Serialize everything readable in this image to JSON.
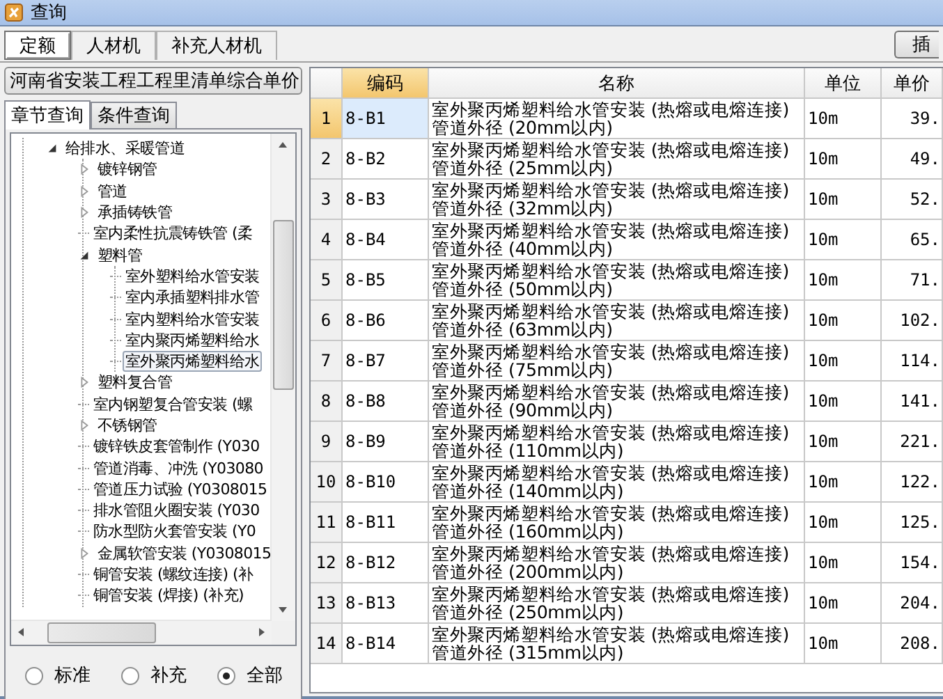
{
  "window": {
    "title": "查询"
  },
  "tabs": [
    {
      "label": "定额",
      "selected": true
    },
    {
      "label": "人材机",
      "selected": false
    },
    {
      "label": "补充人材机",
      "selected": false
    }
  ],
  "insert_button": {
    "label": "插"
  },
  "library_select": {
    "value": "河南省安装工程工程里清单综合单价"
  },
  "sub_tabs": [
    {
      "label": "章节查询",
      "selected": true
    },
    {
      "label": "条件查询",
      "selected": false
    }
  ],
  "tree": [
    {
      "label": "给排水、采暖管道",
      "kind": "node",
      "expanded": true,
      "selected": false,
      "children": [
        {
          "label": "镀锌钢管",
          "kind": "node",
          "expanded": false,
          "selected": false
        },
        {
          "label": "管道",
          "kind": "node",
          "expanded": false,
          "selected": false
        },
        {
          "label": "承插铸铁管",
          "kind": "node",
          "expanded": false,
          "selected": false
        },
        {
          "label": "室内柔性抗震铸铁管 (柔",
          "kind": "leaf",
          "selected": false
        },
        {
          "label": "塑料管",
          "kind": "node",
          "expanded": true,
          "selected": false,
          "children": [
            {
              "label": "室外塑料给水管安装",
              "kind": "leaf",
              "selected": false
            },
            {
              "label": "室内承插塑料排水管",
              "kind": "leaf",
              "selected": false
            },
            {
              "label": "室内塑料给水管安装",
              "kind": "leaf",
              "selected": false
            },
            {
              "label": "室内聚丙烯塑料给水",
              "kind": "leaf",
              "selected": false
            },
            {
              "label": "室外聚丙烯塑料给水",
              "kind": "leaf",
              "selected": true
            }
          ]
        },
        {
          "label": "塑料复合管",
          "kind": "node",
          "expanded": false,
          "selected": false
        },
        {
          "label": "室内钢塑复合管安装 (螺",
          "kind": "leaf",
          "selected": false
        },
        {
          "label": "不锈钢管",
          "kind": "node",
          "expanded": false,
          "selected": false
        },
        {
          "label": "镀锌铁皮套管制作 (Y030",
          "kind": "leaf",
          "selected": false
        },
        {
          "label": "管道消毒、冲洗 (Y03080",
          "kind": "leaf",
          "selected": false
        },
        {
          "label": "管道压力试验 (Y0308015",
          "kind": "leaf",
          "selected": false
        },
        {
          "label": "排水管阻火圈安装 (Y030",
          "kind": "leaf",
          "selected": false
        },
        {
          "label": "防水型防火套管安装 (Y0",
          "kind": "leaf",
          "selected": false
        },
        {
          "label": "金属软管安装 (Y0308015",
          "kind": "node",
          "expanded": false,
          "selected": false
        },
        {
          "label": "铜管安装 (螺纹连接) (补",
          "kind": "leaf",
          "selected": false
        },
        {
          "label": "铜管安装 (焊接) (补充)",
          "kind": "leaf",
          "selected": false
        }
      ]
    }
  ],
  "filter": [
    {
      "label": "标准",
      "selected": false
    },
    {
      "label": "补充",
      "selected": false
    },
    {
      "label": "全部",
      "selected": true
    }
  ],
  "table": {
    "columns": [
      "编码",
      "名称",
      "单位",
      "单价"
    ],
    "rows": [
      {
        "index": "1",
        "code": "8-B1",
        "name": "室外聚丙烯塑料给水管安装 (热熔或电熔连接) 管道外径 (20mm以内)",
        "unit": "10m",
        "price": "39.",
        "selected": true
      },
      {
        "index": "2",
        "code": "8-B2",
        "name": "室外聚丙烯塑料给水管安装 (热熔或电熔连接) 管道外径 (25mm以内)",
        "unit": "10m",
        "price": "49.",
        "selected": false
      },
      {
        "index": "3",
        "code": "8-B3",
        "name": "室外聚丙烯塑料给水管安装 (热熔或电熔连接) 管道外径 (32mm以内)",
        "unit": "10m",
        "price": "52.",
        "selected": false
      },
      {
        "index": "4",
        "code": "8-B4",
        "name": "室外聚丙烯塑料给水管安装 (热熔或电熔连接) 管道外径 (40mm以内)",
        "unit": "10m",
        "price": "65.",
        "selected": false
      },
      {
        "index": "5",
        "code": "8-B5",
        "name": "室外聚丙烯塑料给水管安装 (热熔或电熔连接) 管道外径 (50mm以内)",
        "unit": "10m",
        "price": "71.",
        "selected": false
      },
      {
        "index": "6",
        "code": "8-B6",
        "name": "室外聚丙烯塑料给水管安装 (热熔或电熔连接) 管道外径 (63mm以内)",
        "unit": "10m",
        "price": "102.",
        "selected": false
      },
      {
        "index": "7",
        "code": "8-B7",
        "name": "室外聚丙烯塑料给水管安装 (热熔或电熔连接) 管道外径 (75mm以内)",
        "unit": "10m",
        "price": "114.",
        "selected": false
      },
      {
        "index": "8",
        "code": "8-B8",
        "name": "室外聚丙烯塑料给水管安装 (热熔或电熔连接) 管道外径 (90mm以内)",
        "unit": "10m",
        "price": "141.",
        "selected": false
      },
      {
        "index": "9",
        "code": "8-B9",
        "name": "室外聚丙烯塑料给水管安装 (热熔或电熔连接) 管道外径 (110mm以内)",
        "unit": "10m",
        "price": "221.",
        "selected": false
      },
      {
        "index": "10",
        "code": "8-B10",
        "name": "室外聚丙烯塑料给水管安装 (热熔或电熔连接) 管道外径 (140mm以内)",
        "unit": "10m",
        "price": "122.",
        "selected": false
      },
      {
        "index": "11",
        "code": "8-B11",
        "name": "室外聚丙烯塑料给水管安装 (热熔或电熔连接) 管道外径 (160mm以内)",
        "unit": "10m",
        "price": "125.",
        "selected": false
      },
      {
        "index": "12",
        "code": "8-B12",
        "name": "室外聚丙烯塑料给水管安装 (热熔或电熔连接) 管道外径 (200mm以内)",
        "unit": "10m",
        "price": "154.",
        "selected": false
      },
      {
        "index": "13",
        "code": "8-B13",
        "name": "室外聚丙烯塑料给水管安装 (热熔或电熔连接) 管道外径 (250mm以内)",
        "unit": "10m",
        "price": "204.",
        "selected": false
      },
      {
        "index": "14",
        "code": "8-B14",
        "name": "室外聚丙烯塑料给水管安装 (热熔或电熔连接) 管道外径 (315mm以内)",
        "unit": "10m",
        "price": "208.",
        "selected": false
      }
    ]
  }
}
